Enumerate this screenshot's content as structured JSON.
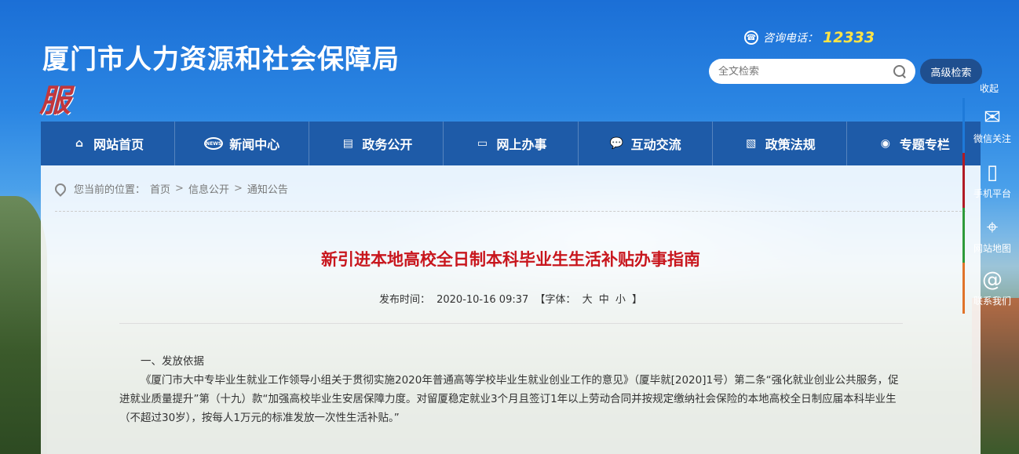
{
  "header": {
    "title": "厦门市人力资源和社会保障局",
    "logo_char": "服",
    "hotline_label": "咨询电话：",
    "hotline_number": "12333",
    "search_placeholder": "全文检索",
    "advanced_search_label": "高级检索"
  },
  "nav": [
    {
      "label": "网站首页",
      "icon": "home-icon"
    },
    {
      "label": "新闻中心",
      "icon": "news-icon"
    },
    {
      "label": "政务公开",
      "icon": "document-icon"
    },
    {
      "label": "网上办事",
      "icon": "monitor-icon"
    },
    {
      "label": "互动交流",
      "icon": "chat-icon"
    },
    {
      "label": "政策法规",
      "icon": "policy-icon"
    },
    {
      "label": "专题专栏",
      "icon": "topic-icon"
    }
  ],
  "breadcrumb": {
    "prefix": "您当前的位置：",
    "items": [
      "首页",
      "信息公开",
      "通知公告"
    ]
  },
  "article": {
    "title": "新引进本地高校全日制本科毕业生生活补贴办事指南",
    "publish_label": "发布时间：",
    "publish_time": "2020-10-16 09:37",
    "font_label": "【字体：",
    "font_large": "大",
    "font_medium": "中",
    "font_small": "小",
    "font_end": "】",
    "section1_heading": "一、发放依据",
    "paragraph1": "《厦门市大中专毕业生就业工作领导小组关于贯彻实施2020年普通高等学校毕业生就业创业工作的意见》（厦毕就[2020]1号）第二条“强化就业创业公共服务，促进就业质量提升”第（十九）款“加强高校毕业生安居保障力度。对留厦稳定就业3个月且签订1年以上劳动合同并按规定缴纳社会保险的本地高校全日制应届本科毕业生（不超过30岁），按每人1万元的标准发放一次性生活补贴。”"
  },
  "float_bar": {
    "collapse_label": "收起",
    "items": [
      {
        "label": "微信关注",
        "icon": "wechat-icon"
      },
      {
        "label": "手机平台",
        "icon": "mobile-icon"
      },
      {
        "label": "网站地图",
        "icon": "map-icon"
      },
      {
        "label": "联系我们",
        "icon": "email-icon"
      }
    ]
  },
  "colors": {
    "nav_bg": "#1e5ba8",
    "title_red": "#c8161d",
    "hotline_yellow": "#ffe445",
    "adv_search_bg": "#1f4f8f"
  }
}
